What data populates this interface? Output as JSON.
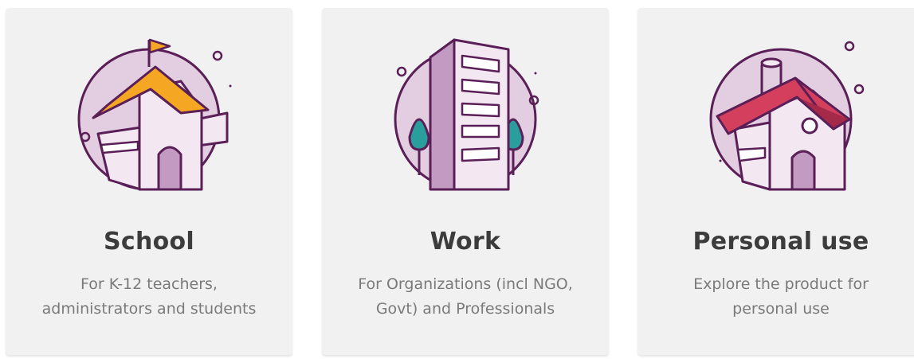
{
  "cards": [
    {
      "id": "school",
      "title": "School",
      "description": "For K-12 teachers, administrators and students",
      "icon": "school-building-icon"
    },
    {
      "id": "work",
      "title": "Work",
      "description": "For Organizations (incl NGO, Govt) and Professionals",
      "icon": "office-building-icon"
    },
    {
      "id": "personal",
      "title": "Personal use",
      "description": "Explore the product for personal use",
      "icon": "house-icon"
    }
  ],
  "colors": {
    "card_bg": "#f1f1f1",
    "circle": "#e2cde1",
    "stroke": "#5a1f57",
    "school_roof": "#f5a623",
    "house_roof": "#d43f5e",
    "tree": "#2a9d9d",
    "title": "#3c3c3c",
    "description": "#7a7a7a"
  }
}
